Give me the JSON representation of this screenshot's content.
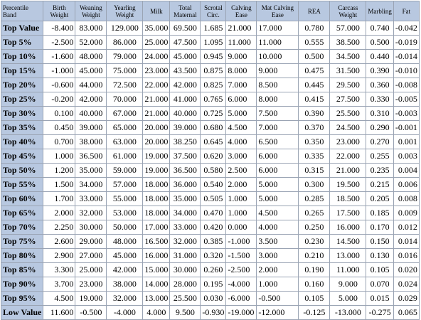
{
  "table": {
    "headers": [
      "Percentile Band",
      "Birth Weight",
      "Weaning Weight",
      "Yearling Weight",
      "Milk",
      "Total Maternal",
      "Scrotal Circ.",
      "Calving Ease",
      "Mat Calving Ease",
      "REA",
      "Carcass Weight",
      "Marbling",
      "Fat"
    ],
    "rows": [
      [
        "Top Value",
        "-8.400",
        "83.000",
        "129.000",
        "35.000",
        "69.500",
        "1.685",
        "21.000",
        "17.000",
        "0.780",
        "57.000",
        "0.740",
        "-0.042"
      ],
      [
        "Top 5%",
        "-2.500",
        "52.000",
        "86.000",
        "25.000",
        "47.500",
        "1.095",
        "11.000",
        "11.000",
        "0.555",
        "38.500",
        "0.500",
        "-0.019"
      ],
      [
        "Top 10%",
        "-1.600",
        "48.000",
        "79.000",
        "24.000",
        "45.000",
        "0.945",
        "9.000",
        "10.000",
        "0.500",
        "34.500",
        "0.440",
        "-0.014"
      ],
      [
        "Top 15%",
        "-1.000",
        "45.000",
        "75.000",
        "23.000",
        "43.500",
        "0.875",
        "8.000",
        "9.000",
        "0.475",
        "31.500",
        "0.390",
        "-0.010"
      ],
      [
        "Top 20%",
        "-0.600",
        "44.000",
        "72.500",
        "22.000",
        "42.000",
        "0.825",
        "7.000",
        "8.500",
        "0.445",
        "29.500",
        "0.360",
        "-0.008"
      ],
      [
        "Top 25%",
        "-0.200",
        "42.000",
        "70.000",
        "21.000",
        "41.000",
        "0.765",
        "6.000",
        "8.000",
        "0.415",
        "27.500",
        "0.330",
        "-0.005"
      ],
      [
        "Top 30%",
        "0.100",
        "40.000",
        "67.000",
        "21.000",
        "40.000",
        "0.725",
        "5.000",
        "7.500",
        "0.390",
        "25.500",
        "0.310",
        "-0.003"
      ],
      [
        "Top 35%",
        "0.450",
        "39.000",
        "65.000",
        "20.000",
        "39.000",
        "0.680",
        "4.500",
        "7.000",
        "0.370",
        "24.500",
        "0.290",
        "-0.001"
      ],
      [
        "Top 40%",
        "0.700",
        "38.000",
        "63.000",
        "20.000",
        "38.250",
        "0.645",
        "4.000",
        "6.500",
        "0.350",
        "23.000",
        "0.270",
        "0.001"
      ],
      [
        "Top 45%",
        "1.000",
        "36.500",
        "61.000",
        "19.000",
        "37.500",
        "0.620",
        "3.000",
        "6.000",
        "0.335",
        "22.000",
        "0.255",
        "0.003"
      ],
      [
        "Top 50%",
        "1.200",
        "35.000",
        "59.000",
        "19.000",
        "36.500",
        "0.580",
        "2.500",
        "6.000",
        "0.315",
        "21.000",
        "0.235",
        "0.004"
      ],
      [
        "Top 55%",
        "1.500",
        "34.000",
        "57.000",
        "18.000",
        "36.000",
        "0.540",
        "2.000",
        "5.000",
        "0.300",
        "19.500",
        "0.215",
        "0.006"
      ],
      [
        "Top 60%",
        "1.700",
        "33.000",
        "55.000",
        "18.000",
        "35.000",
        "0.505",
        "1.000",
        "5.000",
        "0.285",
        "18.500",
        "0.205",
        "0.008"
      ],
      [
        "Top 65%",
        "2.000",
        "32.000",
        "53.000",
        "18.000",
        "34.000",
        "0.470",
        "1.000",
        "4.500",
        "0.265",
        "17.500",
        "0.185",
        "0.009"
      ],
      [
        "Top 70%",
        "2.250",
        "30.000",
        "50.000",
        "17.000",
        "33.000",
        "0.420",
        "0.000",
        "4.000",
        "0.250",
        "16.000",
        "0.170",
        "0.012"
      ],
      [
        "Top 75%",
        "2.600",
        "29.000",
        "48.000",
        "16.500",
        "32.000",
        "0.385",
        "-1.000",
        "3.500",
        "0.230",
        "14.500",
        "0.150",
        "0.014"
      ],
      [
        "Top 80%",
        "2.900",
        "27.000",
        "45.000",
        "16.000",
        "31.000",
        "0.320",
        "-1.500",
        "3.000",
        "0.210",
        "13.000",
        "0.130",
        "0.016"
      ],
      [
        "Top 85%",
        "3.300",
        "25.000",
        "42.000",
        "15.000",
        "30.000",
        "0.260",
        "-2.500",
        "2.000",
        "0.190",
        "11.000",
        "0.105",
        "0.020"
      ],
      [
        "Top 90%",
        "3.700",
        "23.000",
        "38.000",
        "14.000",
        "28.000",
        "0.195",
        "-4.000",
        "1.000",
        "0.160",
        "9.000",
        "0.070",
        "0.024"
      ],
      [
        "Top 95%",
        "4.500",
        "19.000",
        "32.000",
        "13.000",
        "25.500",
        "0.030",
        "-6.000",
        "-0.500",
        "0.105",
        "5.000",
        "0.015",
        "0.029"
      ],
      [
        "Low Value",
        "11.600",
        "-0.500",
        "-4.000",
        "4.000",
        "9.500",
        "-0.930",
        "-19.000",
        "-12.000",
        "-0.125",
        "-13.000",
        "-0.275",
        "0.065"
      ]
    ]
  },
  "colors": {
    "header_bg": "#b8c8e0",
    "grid_line": "#9aa4b4",
    "cell_bg": "#ffffff"
  }
}
